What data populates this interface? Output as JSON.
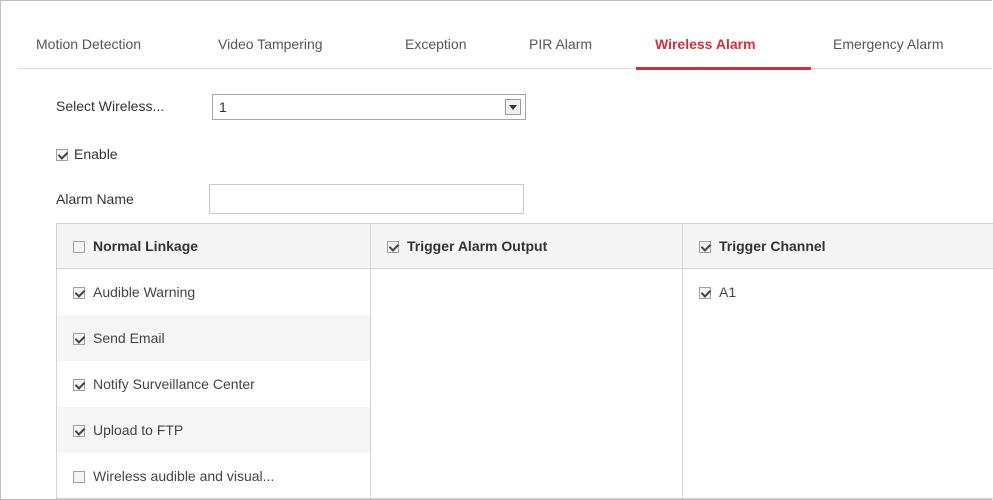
{
  "tabs": [
    {
      "label": "Motion Detection",
      "active": false
    },
    {
      "label": "Video Tampering",
      "active": false
    },
    {
      "label": "Exception",
      "active": false
    },
    {
      "label": "PIR Alarm",
      "active": false
    },
    {
      "label": "Wireless Alarm",
      "active": true
    },
    {
      "label": "Emergency Alarm",
      "active": false
    }
  ],
  "form": {
    "select_wireless_label": "Select Wireless...",
    "select_wireless_value": "1",
    "enable_label": "Enable",
    "enable_checked": true,
    "alarm_name_label": "Alarm Name",
    "alarm_name_value": ""
  },
  "linkage": {
    "normal_linkage": {
      "header": "Normal Linkage",
      "header_checked": false,
      "items": [
        {
          "label": "Audible Warning",
          "checked": true
        },
        {
          "label": "Send Email",
          "checked": true
        },
        {
          "label": "Notify Surveillance Center",
          "checked": true
        },
        {
          "label": "Upload to FTP",
          "checked": true
        },
        {
          "label": "Wireless audible and visual...",
          "checked": false
        }
      ]
    },
    "trigger_alarm_output": {
      "header": "Trigger Alarm Output",
      "header_checked": true
    },
    "trigger_channel": {
      "header": "Trigger Channel",
      "header_checked": true,
      "items": [
        {
          "label": "A1",
          "checked": true
        }
      ]
    }
  },
  "colors": {
    "accent": "#d2303b",
    "border": "#d3d3d3",
    "header_bg": "#f5f5f5"
  }
}
